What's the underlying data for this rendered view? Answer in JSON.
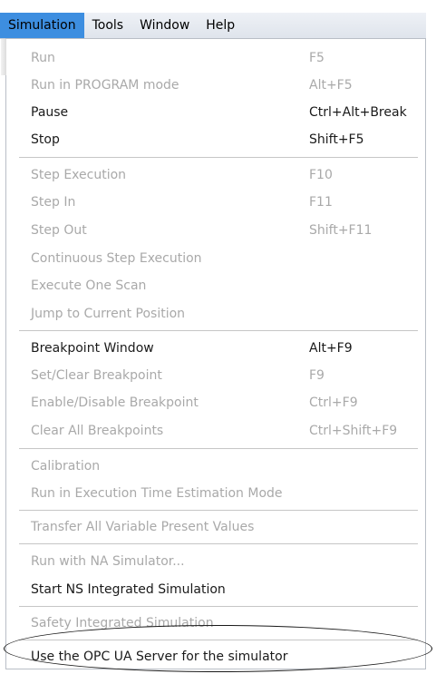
{
  "menubar": {
    "items": [
      "Simulation",
      "Tools",
      "Window",
      "Help"
    ]
  },
  "menu": {
    "items": [
      {
        "label": "Run",
        "shortcut": "F5",
        "enabled": false
      },
      {
        "label": "Run in PROGRAM mode",
        "shortcut": "Alt+F5",
        "enabled": false
      },
      {
        "label": "Pause",
        "shortcut": "Ctrl+Alt+Break",
        "enabled": true
      },
      {
        "label": "Stop",
        "shortcut": "Shift+F5",
        "enabled": true
      },
      {
        "label": "Step Execution",
        "shortcut": "F10",
        "enabled": false
      },
      {
        "label": "Step In",
        "shortcut": "F11",
        "enabled": false
      },
      {
        "label": "Step Out",
        "shortcut": "Shift+F11",
        "enabled": false
      },
      {
        "label": "Continuous Step Execution",
        "shortcut": "",
        "enabled": false
      },
      {
        "label": "Execute One Scan",
        "shortcut": "",
        "enabled": false
      },
      {
        "label": "Jump to Current Position",
        "shortcut": "",
        "enabled": false
      },
      {
        "label": "Breakpoint Window",
        "shortcut": "Alt+F9",
        "enabled": true
      },
      {
        "label": "Set/Clear Breakpoint",
        "shortcut": "F9",
        "enabled": false
      },
      {
        "label": "Enable/Disable Breakpoint",
        "shortcut": "Ctrl+F9",
        "enabled": false
      },
      {
        "label": "Clear All Breakpoints",
        "shortcut": "Ctrl+Shift+F9",
        "enabled": false
      },
      {
        "label": "Calibration",
        "shortcut": "",
        "enabled": false
      },
      {
        "label": "Run in Execution Time Estimation Mode",
        "shortcut": "",
        "enabled": false
      },
      {
        "label": "Transfer All Variable Present Values",
        "shortcut": "",
        "enabled": false
      },
      {
        "label": "Run with NA Simulator...",
        "shortcut": "",
        "enabled": false
      },
      {
        "label": "Start NS Integrated Simulation",
        "shortcut": "",
        "enabled": true
      },
      {
        "label": "Safety Integrated Simulation",
        "shortcut": "",
        "enabled": false
      },
      {
        "label": "Use the OPC UA Server for the simulator",
        "shortcut": "",
        "enabled": true
      }
    ]
  },
  "colors": {
    "active_menu": "#3d8ee0",
    "enabled_text": "#1a1a1a",
    "disabled_text": "#a9a9a9",
    "separator": "#c6c6c6"
  }
}
